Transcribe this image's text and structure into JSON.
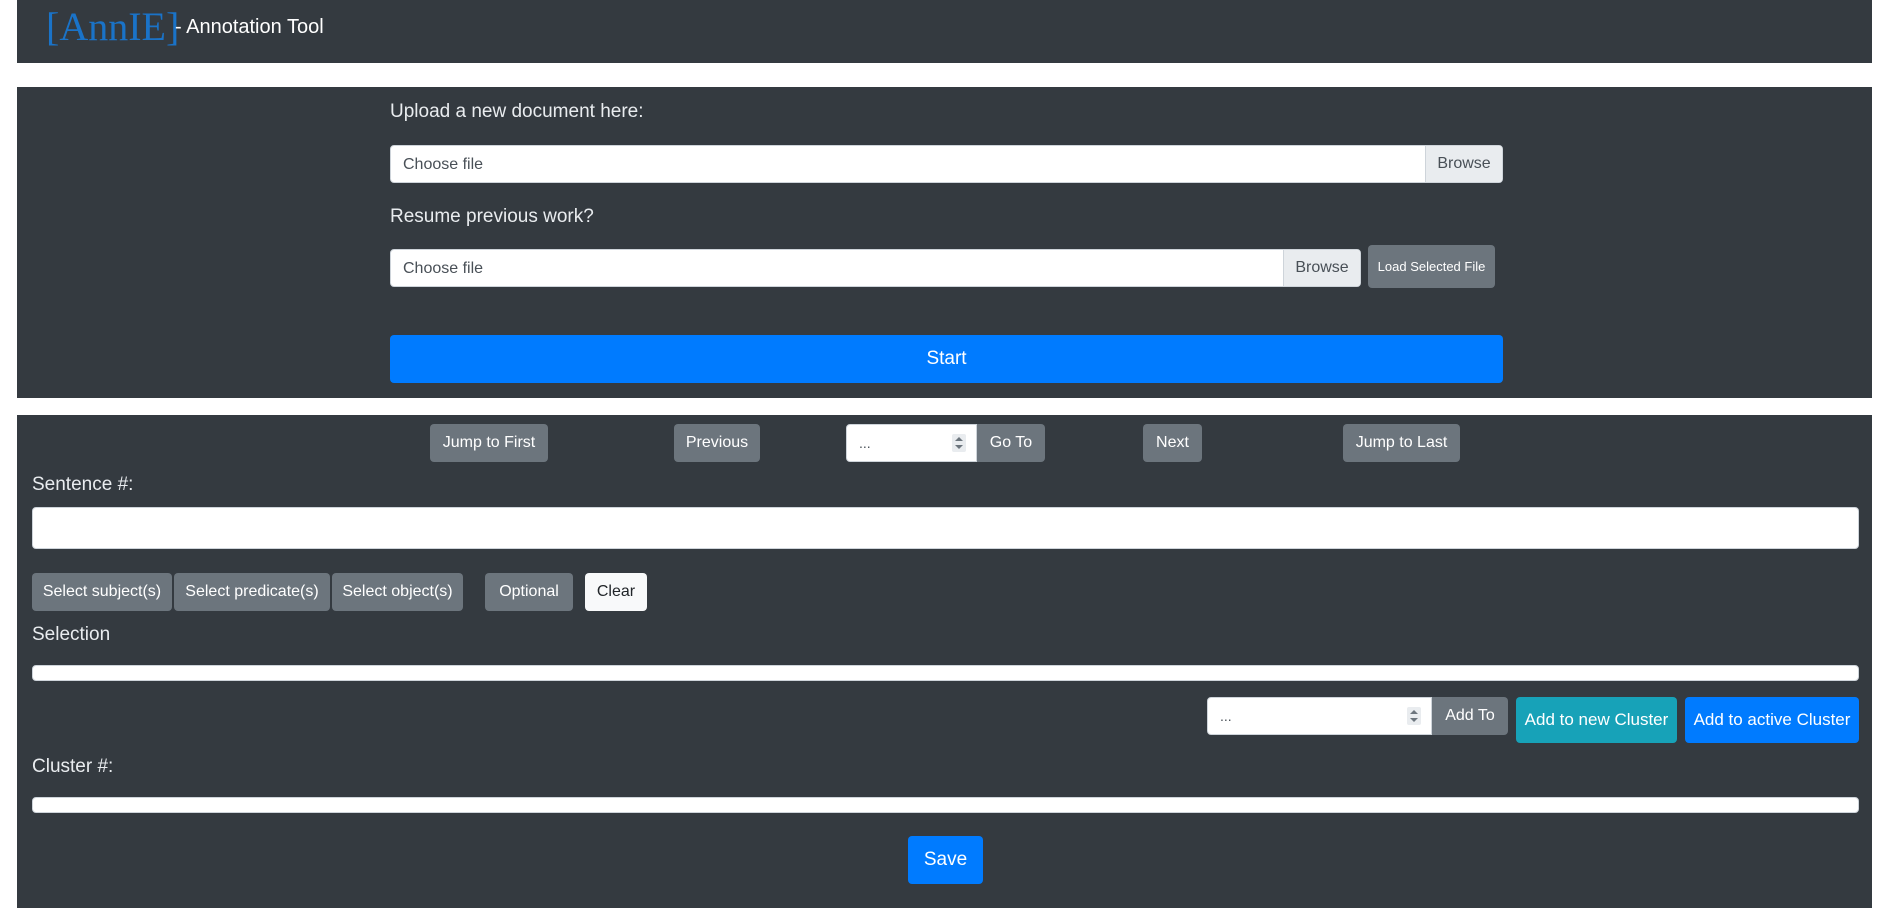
{
  "navbar": {
    "brand": "[AnnIE]",
    "subtitle": "- Annotation Tool"
  },
  "upload": {
    "new_doc_label": "Upload a new document here:",
    "new_doc_placeholder": "Choose file",
    "new_doc_browse": "Browse",
    "resume_label": "Resume previous work?",
    "resume_placeholder": "Choose file",
    "resume_browse": "Browse",
    "load_button": "Load Selected File",
    "start_button": "Start"
  },
  "navigation": {
    "jump_first": "Jump to First",
    "previous": "Previous",
    "goto_value": "...",
    "goto_button": "Go To",
    "next": "Next",
    "jump_last": "Jump to Last"
  },
  "sentence": {
    "label": "Sentence #:",
    "text": ""
  },
  "selectors": {
    "subject": "Select subject(s)",
    "predicate": "Select predicate(s)",
    "object": "Select object(s)",
    "optional": "Optional",
    "clear": "Clear"
  },
  "selection": {
    "label": "Selection",
    "text": ""
  },
  "cluster_actions": {
    "cluster_value": "...",
    "add_to": "Add To",
    "add_new": "Add to new Cluster",
    "add_active": "Add to active Cluster"
  },
  "cluster": {
    "label": "Cluster #:",
    "text": ""
  },
  "save_button": "Save"
}
